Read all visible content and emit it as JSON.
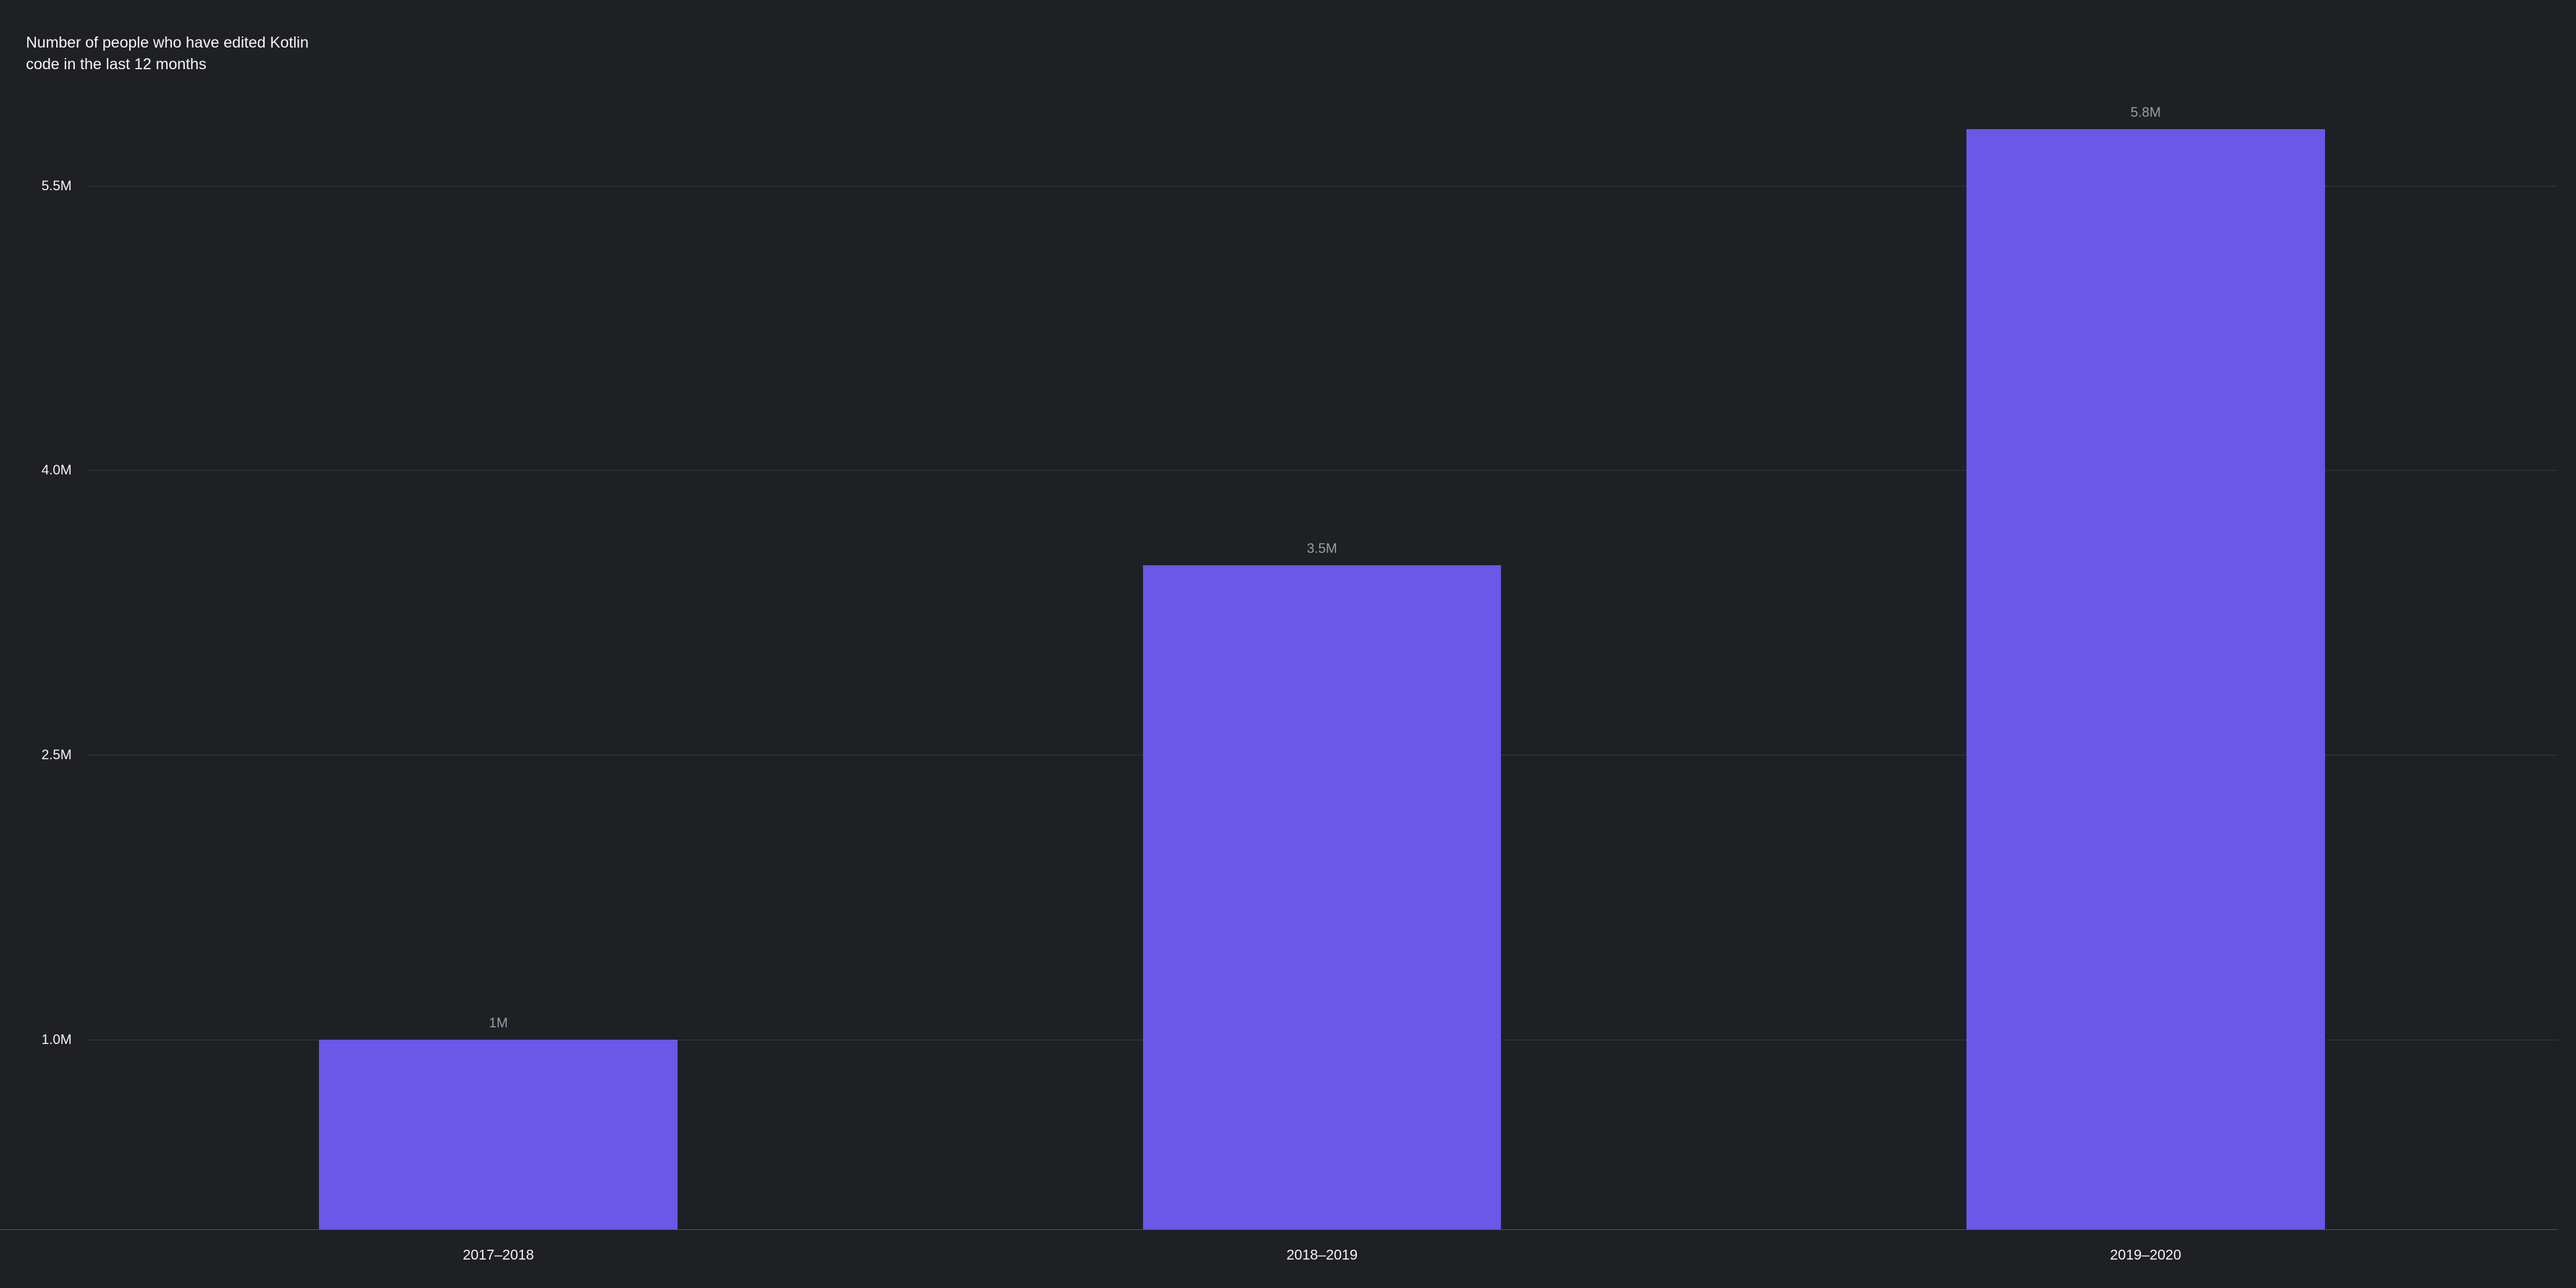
{
  "chart_data": {
    "type": "bar",
    "title": "Number of people who have edited Kotlin code in the last 12 months",
    "categories": [
      "2017–2018",
      "2018–2019",
      "2019–2020"
    ],
    "values": [
      1.0,
      3.5,
      5.8
    ],
    "value_labels": [
      "1M",
      "3.5M",
      "5.8M"
    ],
    "y_ticks": [
      1.0,
      2.5,
      4.0,
      5.5
    ],
    "y_tick_labels": [
      "1.0M",
      "2.5M",
      "4.0M",
      "5.5M"
    ],
    "ylim": [
      0,
      6.3
    ],
    "bar_color": "#6b57e8",
    "bg_color": "#1f2024",
    "grid_color": "#3a3b40",
    "text_color": "#f5f5f5",
    "label_color": "#9a9ca2"
  }
}
